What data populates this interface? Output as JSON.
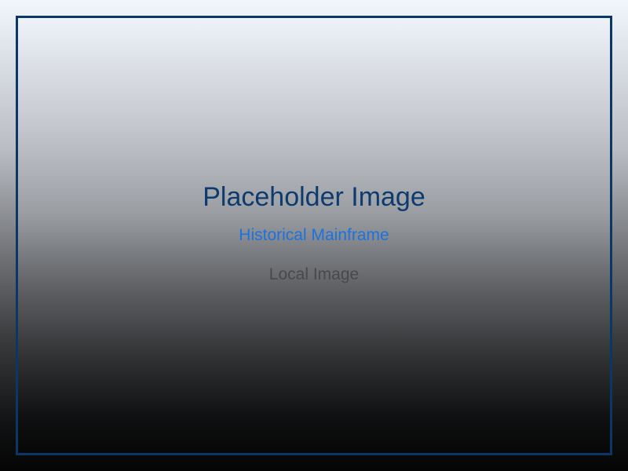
{
  "placeholder": {
    "title": "Placeholder Image",
    "subtitle": "Historical Mainframe",
    "caption": "Local Image"
  },
  "colors": {
    "frame_border": "#0a3768",
    "title": "#0d3b6f",
    "subtitle": "#1a73e0",
    "caption": "#47494c"
  }
}
